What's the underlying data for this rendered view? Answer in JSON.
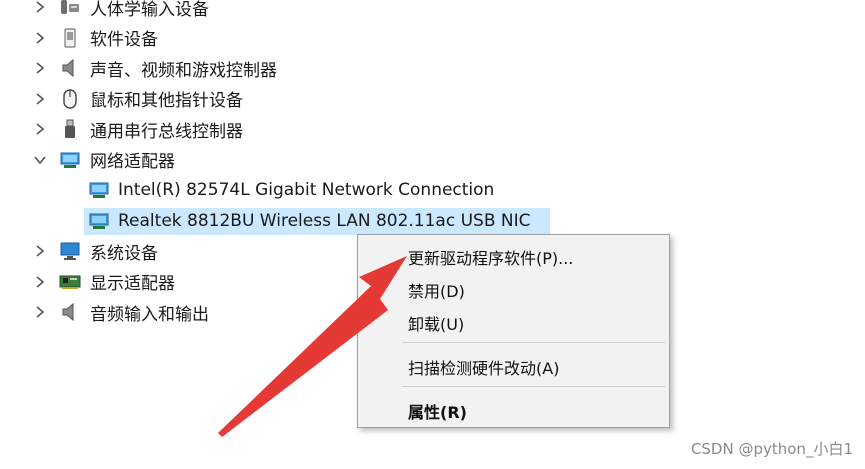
{
  "tree": {
    "items": [
      {
        "label": "人体学输入设备",
        "expanded": false,
        "icon": "hid-device-icon"
      },
      {
        "label": "软件设备",
        "expanded": false,
        "icon": "software-device-icon"
      },
      {
        "label": "声音、视频和游戏控制器",
        "expanded": false,
        "icon": "speaker-icon"
      },
      {
        "label": "鼠标和其他指针设备",
        "expanded": false,
        "icon": "mouse-icon"
      },
      {
        "label": "通用串行总线控制器",
        "expanded": false,
        "icon": "usb-icon"
      },
      {
        "label": "网络适配器",
        "expanded": true,
        "icon": "network-adapter-icon"
      },
      {
        "label": "Intel(R) 82574L Gigabit Network Connection",
        "icon": "network-adapter-icon"
      },
      {
        "label": "Realtek 8812BU Wireless LAN 802.11ac USB NIC",
        "selected": true,
        "icon": "network-adapter-icon"
      },
      {
        "label": "系统设备",
        "expanded": false,
        "icon": "monitor-icon"
      },
      {
        "label": "显示适配器",
        "expanded": false,
        "icon": "display-adapter-icon"
      },
      {
        "label": "音频输入和输出",
        "expanded": false,
        "icon": "speaker-icon"
      }
    ]
  },
  "context_menu": {
    "update_driver": "更新驱动程序软件(P)...",
    "disable": "禁用(D)",
    "uninstall": "卸载(U)",
    "scan": "扫描检测硬件改动(A)",
    "properties": "属性(R)"
  },
  "watermark": "CSDN @python_小白1",
  "colors": {
    "selection": "#cce8ff",
    "arrow": "#e53935",
    "menu_bg": "#f2f2f2"
  }
}
